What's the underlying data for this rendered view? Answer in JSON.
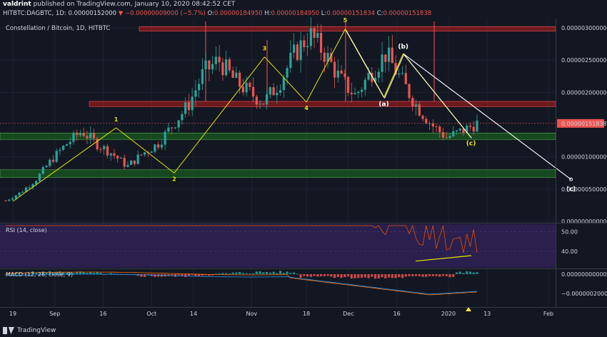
{
  "header": {
    "author": "valdrint",
    "published_text": "published on TradingView.com, January 10, 2020 08:42:52 CET"
  },
  "ohlc_line": {
    "symbol": "HITBTC:DAGBTC, 1D",
    "last": "0.00000152000",
    "change": "▼ −0.00000009000 (−5.7%)",
    "o_label": "O:",
    "o": "0.00000184950",
    "h_label": "H:",
    "h": "0.00000184950",
    "l_label": "L:",
    "l": "0.00000151834",
    "c_label": "C:",
    "c": "0.00000151838"
  },
  "symbol_title": "Constellation / Bitcoin, 1D, HITBTC",
  "footer": {
    "brand": "TradingView"
  },
  "colors": {
    "background": "#131722",
    "up": "#26a69a",
    "down": "#ef5350",
    "wave": "#e6e600",
    "projection": "#ffffff",
    "resistance_zone": "#b71c1c",
    "support_zone": "#1b5e20",
    "rsi_bg": "#2a1f4d",
    "rsi_line": "#e65100",
    "macd_line": "#2196f3",
    "signal_line": "#ff6d00"
  },
  "chart_data": [
    {
      "type": "candlestick",
      "title": "Constellation / Bitcoin, 1D, HITBTC",
      "x_tick_labels": [
        "19",
        "Sep",
        "16",
        "Oct",
        "14",
        "Nov",
        "18",
        "Dec",
        "16",
        "2020",
        "13",
        "Feb"
      ],
      "y_tick_labels": [
        "0.00000300000",
        "0.00000250000",
        "0.00000200000",
        "0.00000151838",
        "0.00000100000",
        "0.00000050000",
        "0.00000000000"
      ],
      "ylim": [
        0,
        3.1e-06
      ],
      "last_price": 1.51838e-06,
      "closes_approx": [
        3.2e-07,
        4.5e-07,
        6.5e-07,
        9.5e-07,
        1.2e-06,
        1.4e-06,
        1.2e-06,
        1.05e-06,
        8.5e-07,
        1.05e-06,
        1.2e-06,
        1.5e-06,
        1.8e-06,
        2.3e-06,
        2.5e-06,
        2.2e-06,
        2e-06,
        1.85e-06,
        2.15e-06,
        2.6e-06,
        2.9e-06,
        2.6e-06,
        2.2e-06,
        1.95e-06,
        2.3e-06,
        2.6e-06,
        2.2e-06,
        1.8e-06,
        1.5e-06,
        1.3e-06,
        1.4e-06,
        1.52e-06
      ],
      "resistance_zones": [
        [
          2.95e-06,
          3.02e-06
        ],
        [
          1.78e-06,
          1.86e-06
        ]
      ],
      "support_zones": [
        [
          1.27e-06,
          1.37e-06
        ],
        [
          6.8e-07,
          8e-07
        ]
      ],
      "wave_labels": [
        "1",
        "2",
        "3",
        "4",
        "5",
        "(a)",
        "(b)",
        "(c)",
        "(c)"
      ],
      "wave_points": [
        {
          "label": "1",
          "x": "Sep 20",
          "y": 1.45e-06
        },
        {
          "label": "2",
          "x": "Oct 8",
          "y": 7.5e-07
        },
        {
          "label": "3",
          "x": "Nov 5",
          "y": 2.55e-06
        },
        {
          "label": "4",
          "x": "Nov 18",
          "y": 1.85e-06
        },
        {
          "label": "5",
          "x": "Nov 30",
          "y": 2.98e-06
        },
        {
          "label": "(a)",
          "x": "Dec 12",
          "y": 1.92e-06
        },
        {
          "label": "(b)",
          "x": "Dec 18",
          "y": 2.6e-06
        },
        {
          "label": "(c)",
          "x": "Jan 8",
          "y": 1.3e-06
        }
      ],
      "projection_target": {
        "label": "(c)",
        "x": "Feb 8",
        "y": 6.5e-07
      }
    },
    {
      "type": "line",
      "title": "RSI (14, close)",
      "y_tick_labels": [
        "50.00",
        "40.00"
      ],
      "ylim": [
        32,
        53
      ]
    },
    {
      "type": "bar",
      "title": "MACD (12, 26, close, 9)",
      "y_tick_labels": [
        "0.00000000000",
        "−0.00000020000"
      ]
    }
  ]
}
